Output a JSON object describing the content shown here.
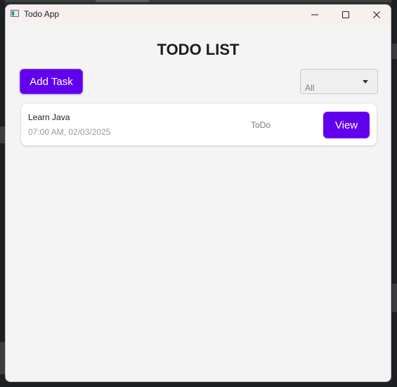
{
  "window": {
    "title": "Todo App",
    "icon": "app-icon",
    "controls": {
      "minimize_icon": "minimize-icon",
      "maximize_icon": "maximize-icon",
      "close_icon": "close-icon"
    }
  },
  "main": {
    "heading": "TODO LIST",
    "add_button_label": "Add Task",
    "filter": {
      "selected": "All",
      "icon": "chevron-down-icon"
    },
    "tasks": [
      {
        "title": "Learn Java",
        "time": "07:00 AM, 02/03/2025",
        "status": "ToDo",
        "action_label": "View"
      }
    ]
  },
  "colors": {
    "accent": "#6200ee",
    "window_bg": "#f4f4f4",
    "titlebar_bg": "#f8efef",
    "card_bg": "#ffffff"
  }
}
